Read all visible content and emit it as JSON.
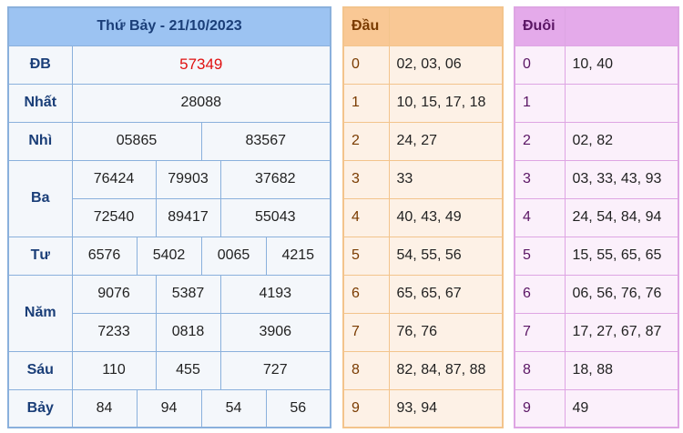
{
  "results": {
    "title": "Thứ Bảy - 21/10/2023",
    "db": {
      "label": "ĐB",
      "values": [
        "57349"
      ]
    },
    "nhat": {
      "label": "Nhất",
      "values": [
        "28088"
      ]
    },
    "nhi": {
      "label": "Nhì",
      "values": [
        "05865",
        "83567"
      ]
    },
    "ba": {
      "label": "Ba",
      "values": [
        "76424",
        "79903",
        "37682",
        "72540",
        "89417",
        "55043"
      ]
    },
    "tu": {
      "label": "Tư",
      "values": [
        "6576",
        "5402",
        "0065",
        "4215"
      ]
    },
    "nam": {
      "label": "Năm",
      "values": [
        "9076",
        "5387",
        "4193",
        "7233",
        "0818",
        "3906"
      ]
    },
    "sau": {
      "label": "Sáu",
      "values": [
        "110",
        "455",
        "727"
      ]
    },
    "bay": {
      "label": "Bảy",
      "values": [
        "84",
        "94",
        "54",
        "56"
      ]
    }
  },
  "dau": {
    "header": "Đầu",
    "rows": [
      {
        "key": "0",
        "value": "02, 03, 06"
      },
      {
        "key": "1",
        "value": "10, 15, 17, 18"
      },
      {
        "key": "2",
        "value": "24, 27"
      },
      {
        "key": "3",
        "value": "33"
      },
      {
        "key": "4",
        "value": "40, 43, 49"
      },
      {
        "key": "5",
        "value": "54, 55, 56"
      },
      {
        "key": "6",
        "value": "65, 65, 67"
      },
      {
        "key": "7",
        "value": "76, 76"
      },
      {
        "key": "8",
        "value": "82, 84, 87, 88"
      },
      {
        "key": "9",
        "value": "93, 94"
      }
    ]
  },
  "duoi": {
    "header": "Đuôi",
    "rows": [
      {
        "key": "0",
        "value": "10, 40"
      },
      {
        "key": "1",
        "value": ""
      },
      {
        "key": "2",
        "value": "02, 82"
      },
      {
        "key": "3",
        "value": "03, 33, 43, 93"
      },
      {
        "key": "4",
        "value": "24, 54, 84, 94"
      },
      {
        "key": "5",
        "value": "15, 55, 65, 65"
      },
      {
        "key": "6",
        "value": "06, 56, 76, 76"
      },
      {
        "key": "7",
        "value": "17, 27, 67, 87"
      },
      {
        "key": "8",
        "value": "18, 88"
      },
      {
        "key": "9",
        "value": "49"
      }
    ]
  },
  "colors": {
    "title_bg": "#9cc3f2",
    "special_prize": "#e01010",
    "dau_accent": "#f9c895",
    "duoi_accent": "#e4aaea"
  }
}
